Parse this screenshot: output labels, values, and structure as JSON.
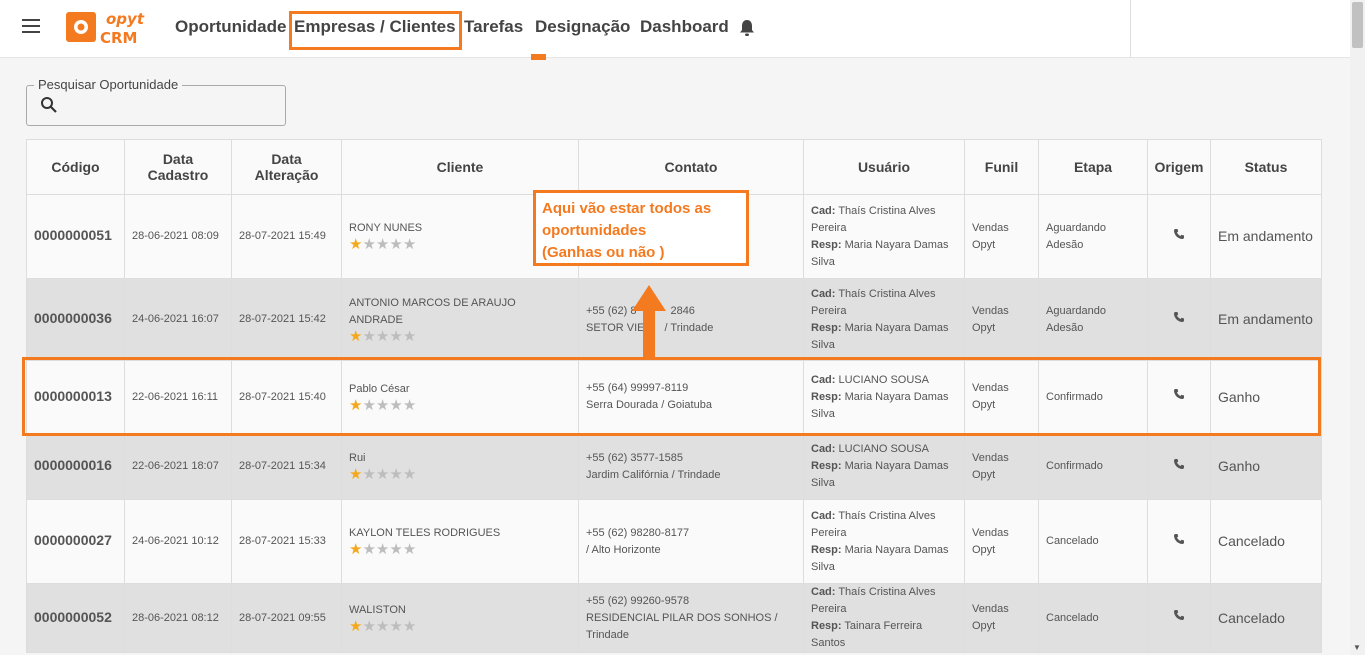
{
  "header": {
    "logo_text_top": "opyt",
    "logo_text_bottom": "CRM",
    "nav": [
      "Oportunidade",
      "Empresas / Clientes",
      "Tarefas",
      "Designação",
      "Dashboard"
    ],
    "active_nav": "Designação",
    "accent_color": "#f47a20"
  },
  "search": {
    "label": "Pesquisar Oportunidade",
    "value": ""
  },
  "table": {
    "headers": [
      "Código",
      "Data Cadastro",
      "Data Alteração",
      "Cliente",
      "Contato",
      "Usuário",
      "Funil",
      "Etapa",
      "Origem",
      "Status"
    ],
    "rows": [
      {
        "codigo": "0000000051",
        "cadastro": "28-06-2021 08:09",
        "alteracao": "28-07-2021 15:49",
        "cliente": "RONY NUNES",
        "rating": 1,
        "contato1": "",
        "contato2": "",
        "cad_label": "Cad:",
        "cad": "Thaís Cristina Alves Pereira",
        "resp_label": "Resp:",
        "resp": "Maria Nayara Damas Silva",
        "funil": "Vendas Opyt",
        "etapa": "Aguardando Adesão",
        "origem_icon": "phone-icon",
        "status": "Em andamento"
      },
      {
        "codigo": "0000000036",
        "cadastro": "24-06-2021 16:07",
        "alteracao": "28-07-2021 15:42",
        "cliente": "ANTONIO MARCOS DE ARAUJO ANDRADE",
        "rating": 1,
        "contato1": "+55 (62) 8",
        "contato1b": "2846",
        "contato2": "SETOR VIE",
        "contato2b": "/ Trindade",
        "cad_label": "Cad:",
        "cad": "Thaís Cristina Alves Pereira",
        "resp_label": "Resp:",
        "resp": "Maria Nayara Damas Silva",
        "funil": "Vendas Opyt",
        "etapa": "Aguardando Adesão",
        "origem_icon": "phone-icon",
        "status": "Em andamento"
      },
      {
        "codigo": "0000000013",
        "cadastro": "22-06-2021 16:11",
        "alteracao": "28-07-2021 15:40",
        "cliente": "Pablo César",
        "rating": 1,
        "contato1": "+55 (64) 99997-8119",
        "contato2": "Serra Dourada / Goiatuba",
        "cad_label": "Cad:",
        "cad": "LUCIANO SOUSA",
        "resp_label": "Resp:",
        "resp": "Maria Nayara Damas Silva",
        "funil": "Vendas Opyt",
        "etapa": "Confirmado",
        "origem_icon": "phone-icon",
        "status": "Ganho"
      },
      {
        "codigo": "0000000016",
        "cadastro": "22-06-2021 18:07",
        "alteracao": "28-07-2021 15:34",
        "cliente": "Rui",
        "rating": 1,
        "contato1": "+55 (62) 3577-1585",
        "contato2": "Jardim Califórnia / Trindade",
        "cad_label": "Cad:",
        "cad": "LUCIANO SOUSA",
        "resp_label": "Resp:",
        "resp": "Maria Nayara Damas Silva",
        "funil": "Vendas Opyt",
        "etapa": "Confirmado",
        "origem_icon": "phone-icon",
        "status": "Ganho"
      },
      {
        "codigo": "0000000027",
        "cadastro": "24-06-2021 10:12",
        "alteracao": "28-07-2021 15:33",
        "cliente": "KAYLON TELES RODRIGUES",
        "rating": 1,
        "contato1": "+55 (62) 98280-8177",
        "contato2": "/ Alto Horizonte",
        "cad_label": "Cad:",
        "cad": "Thaís Cristina Alves Pereira",
        "resp_label": "Resp:",
        "resp": "Maria Nayara Damas Silva",
        "funil": "Vendas Opyt",
        "etapa": "Cancelado",
        "origem_icon": "phone-icon",
        "status": "Cancelado"
      },
      {
        "codigo": "0000000052",
        "cadastro": "28-06-2021 08:12",
        "alteracao": "28-07-2021 09:55",
        "cliente": "WALISTON",
        "rating": 1,
        "contato1": "+55 (62) 99260-9578",
        "contato2": "RESIDENCIAL PILAR DOS SONHOS / Trindade",
        "cad_label": "Cad:",
        "cad": "Thaís Cristina Alves Pereira",
        "resp_label": "Resp:",
        "resp": "Tainara Ferreira Santos",
        "funil": "Vendas Opyt",
        "etapa": "Cancelado",
        "origem_icon": "phone-icon",
        "status": "Cancelado"
      }
    ]
  },
  "annotation": {
    "line1": "Aqui vão estar todos as",
    "line2": "oportunidades",
    "line3": "(Ganhas ou não )"
  }
}
